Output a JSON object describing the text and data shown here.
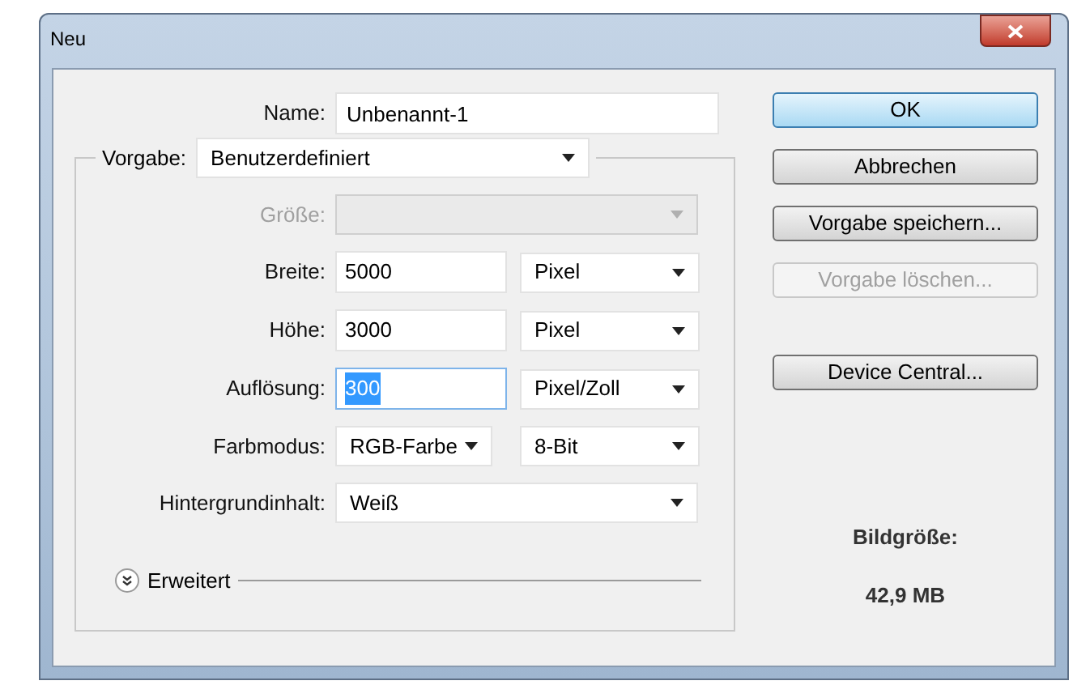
{
  "window": {
    "title": "Neu"
  },
  "name": {
    "label": "Name:",
    "value": "Unbenannt-1"
  },
  "preset": {
    "label": "Vorgabe:",
    "value": "Benutzerdefiniert"
  },
  "rows": [
    {
      "kind": "select",
      "label": "Größe:",
      "disabled": true
    },
    {
      "kind": "value_unit",
      "label": "Breite:",
      "value": "5000",
      "unit": "Pixel",
      "text_selected": false,
      "focused": false
    },
    {
      "kind": "value_unit",
      "label": "Höhe:",
      "value": "3000",
      "unit": "Pixel",
      "text_selected": false,
      "focused": false
    },
    {
      "kind": "value_unit",
      "label": "Auflösung:",
      "value": "300",
      "unit": "Pixel/Zoll",
      "text_selected": true,
      "focused": true
    },
    {
      "kind": "two_selects",
      "label": "Farbmodus:",
      "value": "RGB-Farbe",
      "unit": "8-Bit"
    },
    {
      "kind": "select",
      "label": "Hintergrundinhalt:",
      "value": "Weiß",
      "disabled": false
    }
  ],
  "advanced": {
    "label": "Erweitert",
    "expanded": false
  },
  "buttons": [
    {
      "label": "OK",
      "default": true,
      "disabled": false
    },
    {
      "label": "Abbrechen",
      "default": false,
      "disabled": false
    },
    {
      "label": "Vorgabe speichern...",
      "default": false,
      "disabled": false
    },
    {
      "label": "Vorgabe löschen...",
      "default": false,
      "disabled": true
    },
    {
      "label": "Device Central...",
      "default": false,
      "disabled": false
    }
  ],
  "image_size": {
    "label": "Bildgröße:",
    "value": "42,9 MB"
  }
}
